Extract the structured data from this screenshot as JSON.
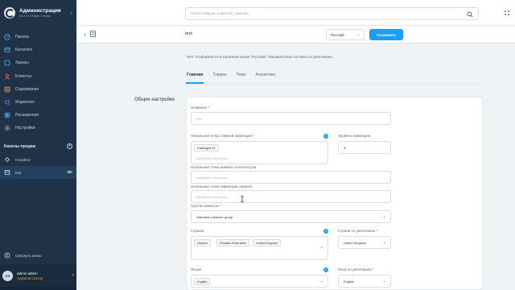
{
  "app": {
    "title": "Администрация",
    "version": "v6.4.7.0 Stable Version"
  },
  "sidebar": {
    "items": [
      {
        "label": "Панель",
        "icon": "dashboard-icon"
      },
      {
        "label": "Каталоги",
        "icon": "catalog-icon"
      },
      {
        "label": "Заказы",
        "icon": "orders-icon"
      },
      {
        "label": "Клиенты",
        "icon": "customers-icon"
      },
      {
        "label": "Содержание",
        "icon": "content-icon"
      },
      {
        "label": "Маркетинг",
        "icon": "marketing-icon"
      },
      {
        "label": "Расширения",
        "icon": "extensions-icon"
      },
      {
        "label": "Настройки",
        "icon": "settings-icon"
      }
    ],
    "channels_title": "Каналы продаж",
    "channels": [
      {
        "label": "Headless",
        "active": false
      },
      {
        "label": "test",
        "active": true
      }
    ],
    "collapse_label": "Свернуть меню",
    "user": {
      "initials": "AA",
      "name": "admin admin",
      "role": "Администратор"
    }
  },
  "search": {
    "placeholder": "Поиск товаров, клиентов, заказов..."
  },
  "actionbar": {
    "title": "test",
    "language": "Русский",
    "save_label": "Сохранить"
  },
  "content": {
    "info": "\"test\" отображается в корневом языке \"Русский\". Базовый язык системы по умолчанию",
    "tabs": [
      {
        "label": "Главная",
        "active": true
      },
      {
        "label": "Товары",
        "active": false
      },
      {
        "label": "Тема",
        "active": false
      },
      {
        "label": "Аналитика",
        "active": false
      }
    ],
    "section_label": "Общие настройки",
    "form": {
      "name_label": "Название *",
      "name_placeholder": "test",
      "nav_entry_label": "Начальная точка главной навигации *",
      "nav_entry_chip": "Catalogue #1",
      "nav_entry_placeholder": "Выберите категорию...",
      "nav_depth_label": "Уровень навигации",
      "nav_depth_value": "3",
      "footer_entry_label": "Начальная точка нижнего колонтитула",
      "footer_entry_placeholder": "Выберите категорию...",
      "service_entry_label": "Начальная точка навигации сервиса",
      "service_entry_placeholder": "Выберите категорию...",
      "customer_group_label": "Группа клиентов *",
      "customer_group_value": "Standard customer group",
      "countries_label": "Страны",
      "countries": [
        "Ukraine",
        "Russian Federation",
        "United Kingdom"
      ],
      "default_country_label": "Страна по умолчанию *",
      "default_country_value": "United Kingdom",
      "languages_label": "Языки",
      "languages": [
        "English"
      ],
      "default_language_label": "Язык по умолчанию *",
      "default_language_value": "English"
    }
  },
  "colors": {
    "sidebar_bg": "#1f3247",
    "accent": "#189eff",
    "role": "#e69a2b"
  }
}
